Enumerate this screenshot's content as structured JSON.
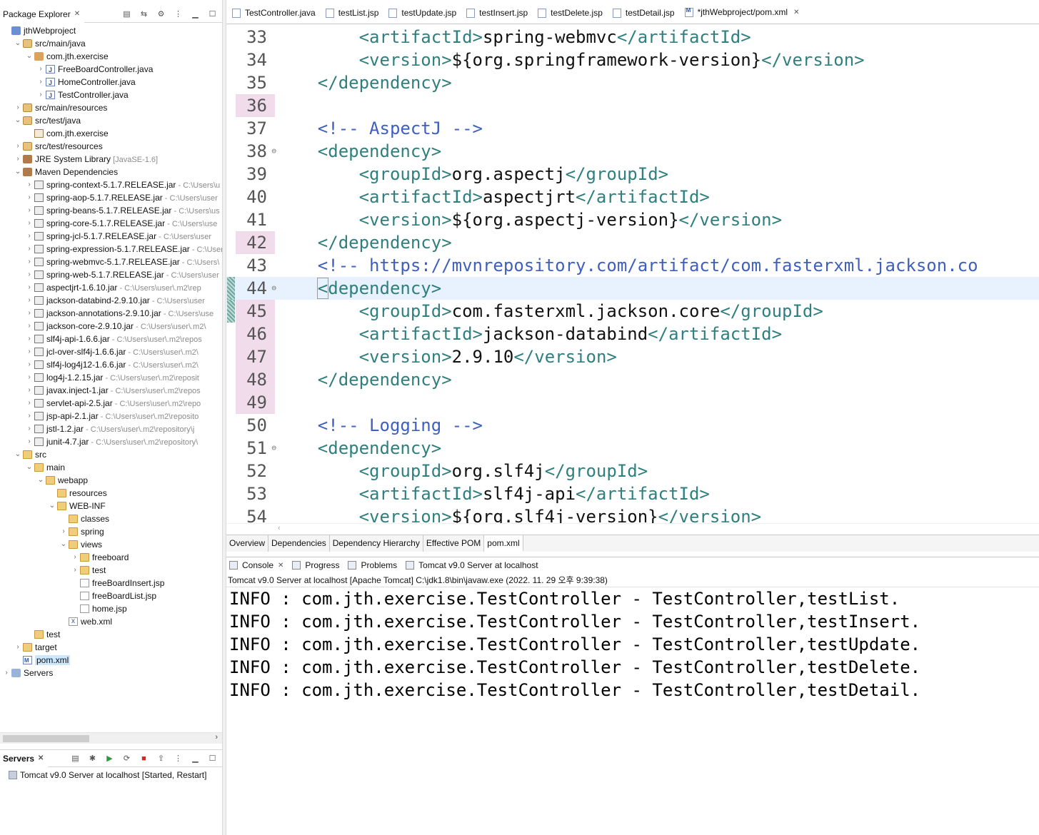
{
  "package_explorer": {
    "title": "Package Explorer",
    "close": "✕",
    "tree": [
      {
        "label": "jthWebproject",
        "extra": "",
        "depth": 0,
        "arrow": "",
        "icon": "proj",
        "icon_name": "maven-project-icon"
      },
      {
        "label": "src/main/java",
        "extra": "",
        "depth": 1,
        "arrow": "v",
        "icon": "srcfolder",
        "icon_name": "source-folder-icon"
      },
      {
        "label": "com.jth.exercise",
        "extra": "",
        "depth": 2,
        "arrow": "v",
        "icon": "pkg",
        "icon_name": "package-icon"
      },
      {
        "label": "FreeBoardController.java",
        "extra": "",
        "depth": 3,
        "arrow": ">",
        "icon": "java",
        "icon_name": "java-file-icon"
      },
      {
        "label": "HomeController.java",
        "extra": "",
        "depth": 3,
        "arrow": ">",
        "icon": "java",
        "icon_name": "java-file-icon"
      },
      {
        "label": "TestController.java",
        "extra": "",
        "depth": 3,
        "arrow": ">",
        "icon": "java",
        "icon_name": "java-file-icon"
      },
      {
        "label": "src/main/resources",
        "extra": "",
        "depth": 1,
        "arrow": ">",
        "icon": "srcfolder",
        "icon_name": "source-folder-icon"
      },
      {
        "label": "src/test/java",
        "extra": "",
        "depth": 1,
        "arrow": "v",
        "icon": "srcfolder",
        "icon_name": "source-folder-icon"
      },
      {
        "label": "com.jth.exercise",
        "extra": "",
        "depth": 2,
        "arrow": "",
        "icon": "pkgempty",
        "icon_name": "empty-package-icon"
      },
      {
        "label": "src/test/resources",
        "extra": "",
        "depth": 1,
        "arrow": ">",
        "icon": "srcfolder",
        "icon_name": "source-folder-icon"
      },
      {
        "label": "JRE System Library",
        "extra": "[JavaSE-1.6]",
        "depth": 1,
        "arrow": ">",
        "icon": "lib",
        "icon_name": "library-icon"
      },
      {
        "label": "Maven Dependencies",
        "extra": "",
        "depth": 1,
        "arrow": "v",
        "icon": "lib",
        "icon_name": "library-icon"
      },
      {
        "label": "spring-context-5.1.7.RELEASE.jar",
        "extra": "- C:\\Users\\u",
        "depth": 2,
        "arrow": ">",
        "icon": "jar",
        "icon_name": "jar-icon"
      },
      {
        "label": "spring-aop-5.1.7.RELEASE.jar",
        "extra": "- C:\\Users\\user",
        "depth": 2,
        "arrow": ">",
        "icon": "jar",
        "icon_name": "jar-icon"
      },
      {
        "label": "spring-beans-5.1.7.RELEASE.jar",
        "extra": "- C:\\Users\\us",
        "depth": 2,
        "arrow": ">",
        "icon": "jar",
        "icon_name": "jar-icon"
      },
      {
        "label": "spring-core-5.1.7.RELEASE.jar",
        "extra": "- C:\\Users\\use",
        "depth": 2,
        "arrow": ">",
        "icon": "jar",
        "icon_name": "jar-icon"
      },
      {
        "label": "spring-jcl-5.1.7.RELEASE.jar",
        "extra": "- C:\\Users\\user",
        "depth": 2,
        "arrow": ">",
        "icon": "jar",
        "icon_name": "jar-icon"
      },
      {
        "label": "spring-expression-5.1.7.RELEASE.jar",
        "extra": "- C:\\User",
        "depth": 2,
        "arrow": ">",
        "icon": "jar",
        "icon_name": "jar-icon"
      },
      {
        "label": "spring-webmvc-5.1.7.RELEASE.jar",
        "extra": "- C:\\Users\\",
        "depth": 2,
        "arrow": ">",
        "icon": "jar",
        "icon_name": "jar-icon"
      },
      {
        "label": "spring-web-5.1.7.RELEASE.jar",
        "extra": "- C:\\Users\\user",
        "depth": 2,
        "arrow": ">",
        "icon": "jar",
        "icon_name": "jar-icon"
      },
      {
        "label": "aspectjrt-1.6.10.jar",
        "extra": "- C:\\Users\\user\\.m2\\rep",
        "depth": 2,
        "arrow": ">",
        "icon": "jar",
        "icon_name": "jar-icon"
      },
      {
        "label": "jackson-databind-2.9.10.jar",
        "extra": "- C:\\Users\\user",
        "depth": 2,
        "arrow": ">",
        "icon": "jar",
        "icon_name": "jar-icon"
      },
      {
        "label": "jackson-annotations-2.9.10.jar",
        "extra": "- C:\\Users\\use",
        "depth": 2,
        "arrow": ">",
        "icon": "jar",
        "icon_name": "jar-icon"
      },
      {
        "label": "jackson-core-2.9.10.jar",
        "extra": "- C:\\Users\\user\\.m2\\",
        "depth": 2,
        "arrow": ">",
        "icon": "jar",
        "icon_name": "jar-icon"
      },
      {
        "label": "slf4j-api-1.6.6.jar",
        "extra": "- C:\\Users\\user\\.m2\\repos",
        "depth": 2,
        "arrow": ">",
        "icon": "jar",
        "icon_name": "jar-icon"
      },
      {
        "label": "jcl-over-slf4j-1.6.6.jar",
        "extra": "- C:\\Users\\user\\.m2\\",
        "depth": 2,
        "arrow": ">",
        "icon": "jar",
        "icon_name": "jar-icon"
      },
      {
        "label": "slf4j-log4j12-1.6.6.jar",
        "extra": "- C:\\Users\\user\\.m2\\",
        "depth": 2,
        "arrow": ">",
        "icon": "jar",
        "icon_name": "jar-icon"
      },
      {
        "label": "log4j-1.2.15.jar",
        "extra": "- C:\\Users\\user\\.m2\\reposit",
        "depth": 2,
        "arrow": ">",
        "icon": "jar",
        "icon_name": "jar-icon"
      },
      {
        "label": "javax.inject-1.jar",
        "extra": "- C:\\Users\\user\\.m2\\repos",
        "depth": 2,
        "arrow": ">",
        "icon": "jar",
        "icon_name": "jar-icon"
      },
      {
        "label": "servlet-api-2.5.jar",
        "extra": "- C:\\Users\\user\\.m2\\repo",
        "depth": 2,
        "arrow": ">",
        "icon": "jar",
        "icon_name": "jar-icon"
      },
      {
        "label": "jsp-api-2.1.jar",
        "extra": "- C:\\Users\\user\\.m2\\reposito",
        "depth": 2,
        "arrow": ">",
        "icon": "jar",
        "icon_name": "jar-icon"
      },
      {
        "label": "jstl-1.2.jar",
        "extra": "- C:\\Users\\user\\.m2\\repository\\j",
        "depth": 2,
        "arrow": ">",
        "icon": "jar",
        "icon_name": "jar-icon"
      },
      {
        "label": "junit-4.7.jar",
        "extra": "- C:\\Users\\user\\.m2\\repository\\",
        "depth": 2,
        "arrow": ">",
        "icon": "jar",
        "icon_name": "jar-icon"
      },
      {
        "label": "src",
        "extra": "",
        "depth": 1,
        "arrow": "v",
        "icon": "folder",
        "icon_name": "folder-icon"
      },
      {
        "label": "main",
        "extra": "",
        "depth": 2,
        "arrow": "v",
        "icon": "folder",
        "icon_name": "folder-icon"
      },
      {
        "label": "webapp",
        "extra": "",
        "depth": 3,
        "arrow": "v",
        "icon": "folder",
        "icon_name": "folder-icon"
      },
      {
        "label": "resources",
        "extra": "",
        "depth": 4,
        "arrow": "",
        "icon": "folder",
        "icon_name": "folder-icon"
      },
      {
        "label": "WEB-INF",
        "extra": "",
        "depth": 4,
        "arrow": "v",
        "icon": "folder",
        "icon_name": "folder-icon"
      },
      {
        "label": "classes",
        "extra": "",
        "depth": 5,
        "arrow": "",
        "icon": "folder",
        "icon_name": "folder-icon"
      },
      {
        "label": "spring",
        "extra": "",
        "depth": 5,
        "arrow": ">",
        "icon": "folder",
        "icon_name": "folder-icon"
      },
      {
        "label": "views",
        "extra": "",
        "depth": 5,
        "arrow": "v",
        "icon": "folder",
        "icon_name": "folder-icon"
      },
      {
        "label": "freeboard",
        "extra": "",
        "depth": 6,
        "arrow": ">",
        "icon": "folder",
        "icon_name": "folder-icon"
      },
      {
        "label": "test",
        "extra": "",
        "depth": 6,
        "arrow": ">",
        "icon": "folder",
        "icon_name": "folder-icon"
      },
      {
        "label": "freeBoardInsert.jsp",
        "extra": "",
        "depth": 6,
        "arrow": "",
        "icon": "jsp",
        "icon_name": "jsp-file-icon"
      },
      {
        "label": "freeBoardList.jsp",
        "extra": "",
        "depth": 6,
        "arrow": "",
        "icon": "jsp",
        "icon_name": "jsp-file-icon"
      },
      {
        "label": "home.jsp",
        "extra": "",
        "depth": 6,
        "arrow": "",
        "icon": "jsp",
        "icon_name": "jsp-file-icon"
      },
      {
        "label": "web.xml",
        "extra": "",
        "depth": 5,
        "arrow": "",
        "icon": "xml",
        "icon_name": "xml-file-icon"
      },
      {
        "label": "test",
        "extra": "",
        "depth": 2,
        "arrow": "",
        "icon": "folder",
        "icon_name": "folder-icon"
      },
      {
        "label": "target",
        "extra": "",
        "depth": 1,
        "arrow": ">",
        "icon": "folder",
        "icon_name": "folder-icon"
      },
      {
        "label": "pom.xml",
        "extra": "",
        "depth": 1,
        "arrow": "",
        "icon": "pom",
        "icon_name": "pom-file-icon",
        "selected": true
      },
      {
        "label": "Servers",
        "extra": "",
        "depth": 0,
        "arrow": ">",
        "icon": "servers",
        "icon_name": "servers-project-icon"
      }
    ]
  },
  "servers_view": {
    "title": "Servers",
    "close": "✕",
    "entries": [
      {
        "label": "Tomcat v9.0 Server at localhost",
        "status": "[Started, Restart]"
      }
    ]
  },
  "editor": {
    "tabs": [
      {
        "label": "TestController.java",
        "icon": "java"
      },
      {
        "label": "testList.jsp",
        "icon": "jsp"
      },
      {
        "label": "testUpdate.jsp",
        "icon": "jsp"
      },
      {
        "label": "testInsert.jsp",
        "icon": "jsp"
      },
      {
        "label": "testDelete.jsp",
        "icon": "jsp"
      },
      {
        "label": "testDetail.jsp",
        "icon": "jsp"
      },
      {
        "label": "*jthWebproject/pom.xml",
        "icon": "pom",
        "active": true
      }
    ],
    "close": "✕",
    "lines": [
      {
        "n": "33",
        "mark": false,
        "fold": false,
        "change": false,
        "cur": false,
        "parts": [
          [
            "t",
            "        "
          ],
          [
            "tag",
            "<artifactId>"
          ],
          [
            "t",
            "spring-webmvc"
          ],
          [
            "tag",
            "</artifactId>"
          ]
        ]
      },
      {
        "n": "34",
        "mark": false,
        "fold": false,
        "change": false,
        "cur": false,
        "parts": [
          [
            "t",
            "        "
          ],
          [
            "tag",
            "<version>"
          ],
          [
            "t",
            "${org.springframework-version}"
          ],
          [
            "tag",
            "</version>"
          ]
        ]
      },
      {
        "n": "35",
        "mark": false,
        "fold": false,
        "change": false,
        "cur": false,
        "parts": [
          [
            "t",
            "    "
          ],
          [
            "tag",
            "</dependency>"
          ]
        ]
      },
      {
        "n": "36",
        "mark": true,
        "fold": false,
        "change": false,
        "cur": false,
        "parts": []
      },
      {
        "n": "37",
        "mark": false,
        "fold": false,
        "change": false,
        "cur": false,
        "parts": [
          [
            "t",
            "    "
          ],
          [
            "com",
            "<!-- AspectJ -->"
          ]
        ]
      },
      {
        "n": "38",
        "mark": false,
        "fold": true,
        "change": false,
        "cur": false,
        "parts": [
          [
            "t",
            "    "
          ],
          [
            "tag",
            "<dependency>"
          ]
        ]
      },
      {
        "n": "39",
        "mark": false,
        "fold": false,
        "change": false,
        "cur": false,
        "parts": [
          [
            "t",
            "        "
          ],
          [
            "tag",
            "<groupId>"
          ],
          [
            "t",
            "org.aspectj"
          ],
          [
            "tag",
            "</groupId>"
          ]
        ]
      },
      {
        "n": "40",
        "mark": false,
        "fold": false,
        "change": false,
        "cur": false,
        "parts": [
          [
            "t",
            "        "
          ],
          [
            "tag",
            "<artifactId>"
          ],
          [
            "t",
            "aspectjrt"
          ],
          [
            "tag",
            "</artifactId>"
          ]
        ]
      },
      {
        "n": "41",
        "mark": false,
        "fold": false,
        "change": false,
        "cur": false,
        "parts": [
          [
            "t",
            "        "
          ],
          [
            "tag",
            "<version>"
          ],
          [
            "t",
            "${org.aspectj-version}"
          ],
          [
            "tag",
            "</version>"
          ]
        ]
      },
      {
        "n": "42",
        "mark": true,
        "fold": false,
        "change": false,
        "cur": false,
        "parts": [
          [
            "t",
            "    "
          ],
          [
            "tag",
            "</dependency>"
          ]
        ]
      },
      {
        "n": "43",
        "mark": false,
        "fold": false,
        "change": false,
        "cur": false,
        "parts": [
          [
            "t",
            "    "
          ],
          [
            "com",
            "<!-- https://mvnrepository.com/artifact/com.fasterxml.jackson.co"
          ]
        ]
      },
      {
        "n": "44",
        "mark": false,
        "fold": true,
        "change": true,
        "cur": true,
        "parts": [
          [
            "t",
            "    "
          ],
          [
            "tagbox",
            "<"
          ],
          [
            "tag",
            "dependency>"
          ]
        ]
      },
      {
        "n": "45",
        "mark": true,
        "fold": false,
        "change": true,
        "cur": false,
        "parts": [
          [
            "t",
            "        "
          ],
          [
            "tag",
            "<groupId>"
          ],
          [
            "t",
            "com.fasterxml.jackson.core"
          ],
          [
            "tag",
            "</groupId>"
          ]
        ]
      },
      {
        "n": "46",
        "mark": true,
        "fold": false,
        "change": false,
        "cur": false,
        "parts": [
          [
            "t",
            "        "
          ],
          [
            "tag",
            "<artifactId>"
          ],
          [
            "t",
            "jackson-databind"
          ],
          [
            "tag",
            "</artifactId>"
          ]
        ]
      },
      {
        "n": "47",
        "mark": true,
        "fold": false,
        "change": false,
        "cur": false,
        "parts": [
          [
            "t",
            "        "
          ],
          [
            "tag",
            "<version>"
          ],
          [
            "t",
            "2.9.10"
          ],
          [
            "tag",
            "</version>"
          ]
        ]
      },
      {
        "n": "48",
        "mark": true,
        "fold": false,
        "change": false,
        "cur": false,
        "parts": [
          [
            "t",
            "    "
          ],
          [
            "tag",
            "</dependency>"
          ]
        ]
      },
      {
        "n": "49",
        "mark": true,
        "fold": false,
        "change": false,
        "cur": false,
        "parts": []
      },
      {
        "n": "50",
        "mark": false,
        "fold": false,
        "change": false,
        "cur": false,
        "parts": [
          [
            "t",
            "    "
          ],
          [
            "com",
            "<!-- Logging -->"
          ]
        ]
      },
      {
        "n": "51",
        "mark": false,
        "fold": true,
        "change": false,
        "cur": false,
        "parts": [
          [
            "t",
            "    "
          ],
          [
            "tag",
            "<dependency>"
          ]
        ]
      },
      {
        "n": "52",
        "mark": false,
        "fold": false,
        "change": false,
        "cur": false,
        "parts": [
          [
            "t",
            "        "
          ],
          [
            "tag",
            "<groupId>"
          ],
          [
            "t",
            "org.slf4j"
          ],
          [
            "tag",
            "</groupId>"
          ]
        ]
      },
      {
        "n": "53",
        "mark": false,
        "fold": false,
        "change": false,
        "cur": false,
        "parts": [
          [
            "t",
            "        "
          ],
          [
            "tag",
            "<artifactId>"
          ],
          [
            "t",
            "slf4j-api"
          ],
          [
            "tag",
            "</artifactId>"
          ]
        ]
      },
      {
        "n": "54",
        "mark": false,
        "fold": false,
        "change": false,
        "cur": false,
        "parts": [
          [
            "t",
            "        "
          ],
          [
            "tag",
            "<version>"
          ],
          [
            "t",
            "${org.slf4j-version}"
          ],
          [
            "tag",
            "</version>"
          ]
        ]
      }
    ],
    "pom_tabs": [
      {
        "label": "Overview"
      },
      {
        "label": "Dependencies"
      },
      {
        "label": "Dependency Hierarchy"
      },
      {
        "label": "Effective POM"
      },
      {
        "label": "pom.xml",
        "active": true
      }
    ]
  },
  "console": {
    "tabs": [
      {
        "label": "Console",
        "closable": true,
        "icon_name": "console-icon"
      },
      {
        "label": "Progress",
        "closable": false,
        "icon_name": "progress-icon"
      },
      {
        "label": "Problems",
        "closable": false,
        "icon_name": "problems-icon"
      },
      {
        "label": "Tomcat v9.0 Server at localhost",
        "closable": false,
        "icon_name": "server-icon"
      }
    ],
    "close": "✕",
    "description": "Tomcat v9.0 Server at localhost [Apache Tomcat] C:\\jdk1.8\\bin\\javaw.exe  (2022. 11. 29 오후 9:39:38)",
    "log": [
      "INFO : com.jth.exercise.TestController - TestController,testList.",
      "INFO : com.jth.exercise.TestController - TestController,testInsert.",
      "INFO : com.jth.exercise.TestController - TestController,testUpdate.",
      "INFO : com.jth.exercise.TestController - TestController,testDelete.",
      "INFO : com.jth.exercise.TestController - TestController,testDetail."
    ]
  },
  "colors": {
    "xml_tag": "#2f7f7f",
    "xml_comment": "#3f5fbf",
    "current_line": "#e8f2fe",
    "occurrence_mark": "#f0dcea",
    "selection": "#cce8ff"
  }
}
